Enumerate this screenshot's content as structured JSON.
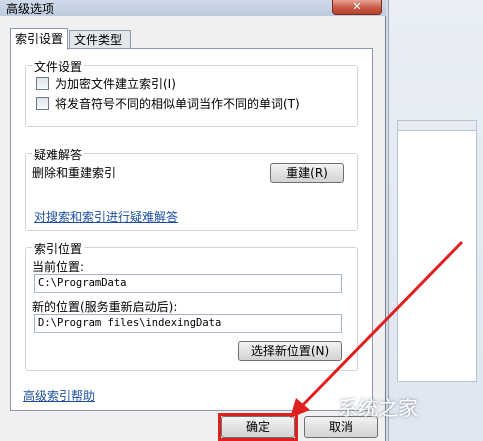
{
  "window": {
    "title": "高级选项",
    "close_glyph": "✕"
  },
  "tabs": [
    {
      "label": "索引设置",
      "active": true
    },
    {
      "label": "文件类型",
      "active": false
    }
  ],
  "file_settings": {
    "title": "文件设置",
    "options": [
      {
        "label": "为加密文件建立索引(I)",
        "checked": false
      },
      {
        "label": "将发音符号不同的相似单词当作不同的单词(T)",
        "checked": false
      }
    ]
  },
  "troubleshoot": {
    "title": "疑难解答",
    "text": "删除和重建索引",
    "rebuild_button": "重建(R)",
    "link": "对搜索和索引进行疑难解答"
  },
  "index_location": {
    "title": "索引位置",
    "current_label": "当前位置:",
    "current_value": "C:\\ProgramData",
    "new_label": "新的位置(服务重新启动后):",
    "new_value": "D:\\Program files\\indexingData",
    "select_button": "选择新位置(N)"
  },
  "help_link": "高级索引帮助",
  "footer": {
    "ok_button": "确定",
    "cancel_button": "取消"
  },
  "watermark": "系统之家",
  "colors": {
    "highlight": "#e02020",
    "link": "#1b4f9e"
  }
}
